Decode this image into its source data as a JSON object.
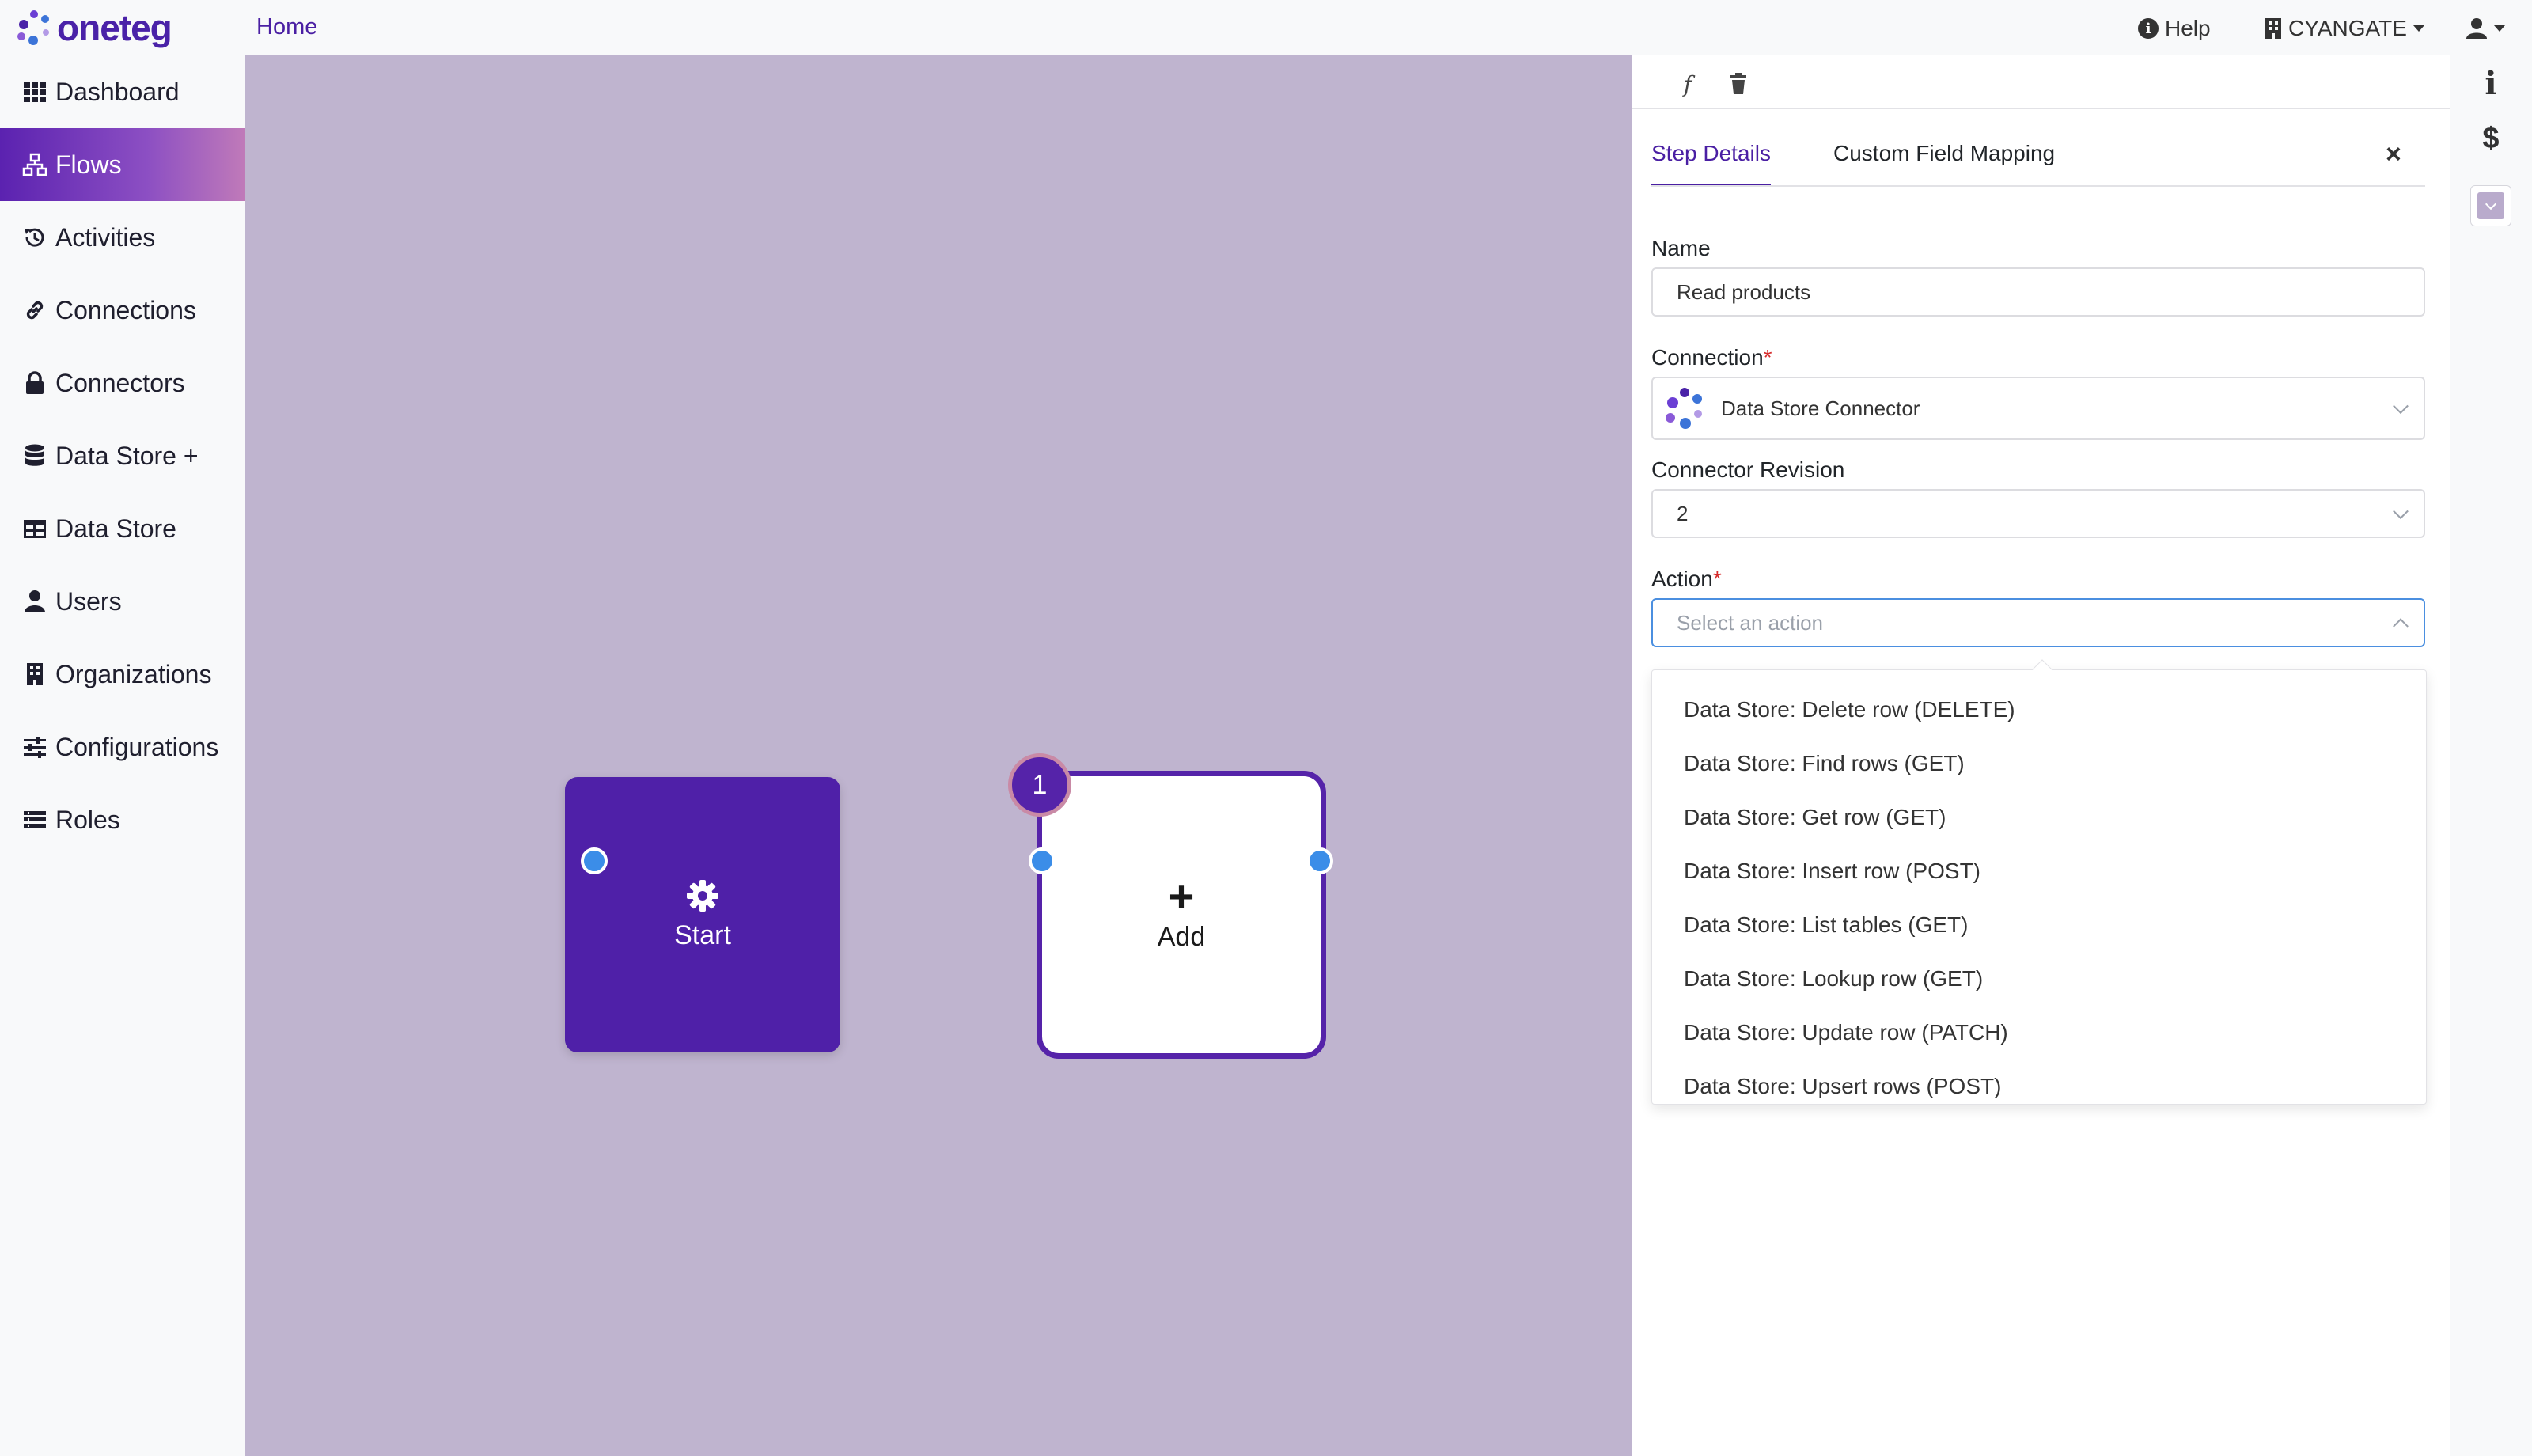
{
  "brand": {
    "name": "oneteg"
  },
  "topbar": {
    "home": "Home",
    "help": "Help",
    "organization": "CYANGATE"
  },
  "sidebar": {
    "items": [
      {
        "label": "Dashboard",
        "icon": "grid-icon"
      },
      {
        "label": "Flows",
        "icon": "sitemap-icon",
        "active": true
      },
      {
        "label": "Activities",
        "icon": "history-icon"
      },
      {
        "label": "Connections",
        "icon": "link-icon"
      },
      {
        "label": "Connectors",
        "icon": "lock-icon"
      },
      {
        "label": "Data Store +",
        "icon": "database-icon"
      },
      {
        "label": "Data Store",
        "icon": "table-icon"
      },
      {
        "label": "Users",
        "icon": "user-icon"
      },
      {
        "label": "Organizations",
        "icon": "building-icon"
      },
      {
        "label": "Configurations",
        "icon": "sliders-icon"
      },
      {
        "label": "Roles",
        "icon": "list-icon"
      }
    ]
  },
  "canvas": {
    "start_node": {
      "label": "Start",
      "icon": "gear-icon"
    },
    "add_node": {
      "label": "Add",
      "icon": "plus-icon",
      "step_number": "1"
    }
  },
  "panel": {
    "toolbar": {
      "function_label": "f",
      "delete_icon": "trash-icon"
    },
    "tabs": [
      {
        "label": "Step Details",
        "active": true
      },
      {
        "label": "Custom Field Mapping",
        "active": false
      }
    ],
    "close_label": "×",
    "fields": {
      "name": {
        "label": "Name",
        "value": "Read products"
      },
      "connection": {
        "label": "Connection",
        "required_mark": "*",
        "value": "Data Store Connector"
      },
      "connector_revision": {
        "label": "Connector Revision",
        "value": "2"
      },
      "action": {
        "label": "Action",
        "required_mark": "*",
        "placeholder": "Select an action"
      }
    },
    "action_options": [
      "Data Store: Delete row (DELETE)",
      "Data Store: Find rows (GET)",
      "Data Store: Get row (GET)",
      "Data Store: Insert row (POST)",
      "Data Store: List tables (GET)",
      "Data Store: Lookup row (GET)",
      "Data Store: Update row (PATCH)",
      "Data Store: Upsert rows (POST)"
    ]
  },
  "rail": {
    "info_label": "i",
    "billing_label": "$"
  },
  "colors": {
    "brand_purple": "#4f20a8",
    "canvas_bg": "#bfb4cf",
    "port_blue": "#3b8de8",
    "required_red": "#d62b2b"
  }
}
